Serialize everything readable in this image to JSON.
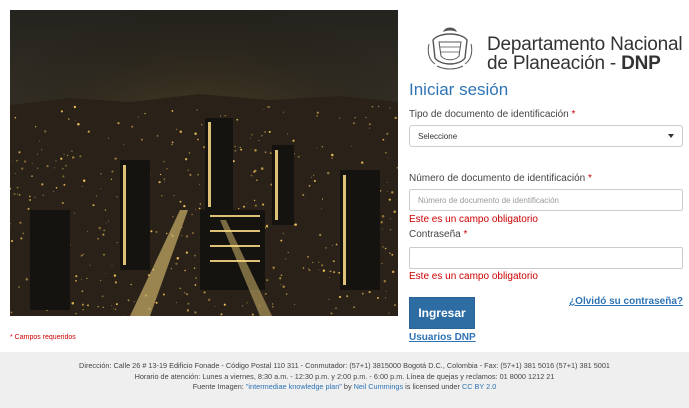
{
  "brand": {
    "line1": "Departamento Nacional",
    "line2_prefix": "de Planeación - ",
    "line2_bold": "DNP",
    "seal_icon": "colombia-coat-of-arms-icon"
  },
  "form": {
    "title": "Iniciar sesión",
    "doc_type_label": "Tipo de documento de identificación",
    "doc_type_selected": "Seleccione",
    "doc_number_label": "Número de documento de identificación",
    "doc_number_placeholder": "Número de documento de identificación",
    "doc_number_error": "Este es un campo obligatorio",
    "password_label": "Contraseña",
    "password_value": "",
    "password_error": "Este es un campo obligatorio",
    "required_star": "*",
    "login_button": "Ingresar",
    "forgot_link": "¿Olvidó su contraseña?",
    "users_link": "Usuarios DNP"
  },
  "required_note": "* Campos requeridos",
  "footer": {
    "line1": "Dirección: Calle 26 # 13-19 Edificio Fonade - Código Postal 110 311 - Conmutador: (57+1) 3815000 Bogotá D.C., Colombia - Fax: (57+1) 381 5016 (57+1) 381 5001",
    "line2": "Horario de atención: Lunes a viernes, 8:30 a.m. - 12:30 p.m. y 2:00 p.m. - 6:00 p.m. Línea de quejas y reclamos: 01 8000 1212 21",
    "line3_prefix": "Fuente Imagen: ",
    "line3_image_link": "\"intermediae knowledge plan\"",
    "line3_by": " by ",
    "line3_author_link": "Neil Cummings",
    "line3_license_text": " is licensed under ",
    "line3_license_link": "CC BY 2.0"
  },
  "colors": {
    "accent": "#2e74b5",
    "button": "#2e6da4",
    "error": "#cc0000",
    "footer_bg": "#efefef"
  }
}
